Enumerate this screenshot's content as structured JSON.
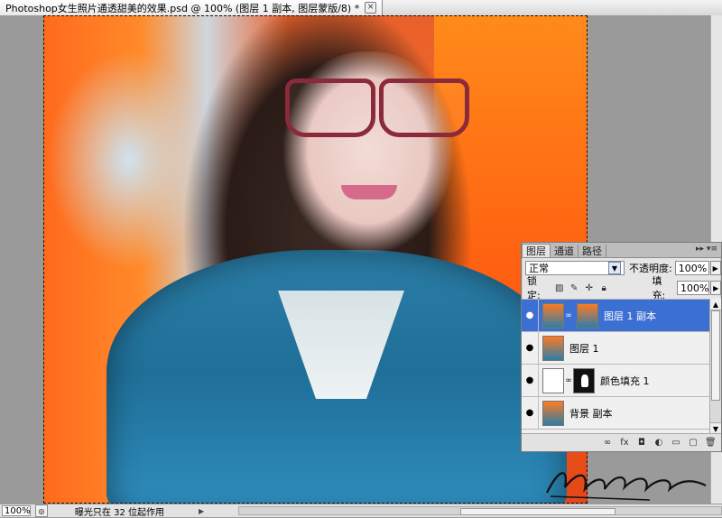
{
  "document": {
    "tab_title": "Photoshop女生照片通透甜美的效果.psd @ 100% (图层 1 副本, 图层蒙版/8) *",
    "close_glyph": "×"
  },
  "status_bar": {
    "zoom": "100%",
    "info": "曝光只在 32 位起作用",
    "arrow": "▶"
  },
  "layers_panel": {
    "tabs": [
      {
        "label": "图层",
        "active": true
      },
      {
        "label": "通道",
        "active": false
      },
      {
        "label": "路径",
        "active": false
      }
    ],
    "menu_glyph": "▸▸ ▾≡",
    "blend_mode": "正常",
    "opacity_label": "不透明度:",
    "opacity_value": "100%",
    "lock_label": "锁定:",
    "fill_label": "填充:",
    "fill_value": "100%",
    "layers": [
      {
        "name": "图层 1 副本",
        "selected": true,
        "has_mask": true
      },
      {
        "name": "图层 1",
        "selected": false,
        "has_mask": false
      },
      {
        "name": "颜色填充 1",
        "selected": false,
        "has_mask": true
      },
      {
        "name": "背景 副本",
        "selected": false,
        "has_mask": false
      }
    ]
  },
  "signature_text": "Huoshanzuo",
  "colors": {
    "selected_layer": "#3c6fd2",
    "panel_bg": "#e6e6e6",
    "workspace": "#9a9a9a"
  }
}
